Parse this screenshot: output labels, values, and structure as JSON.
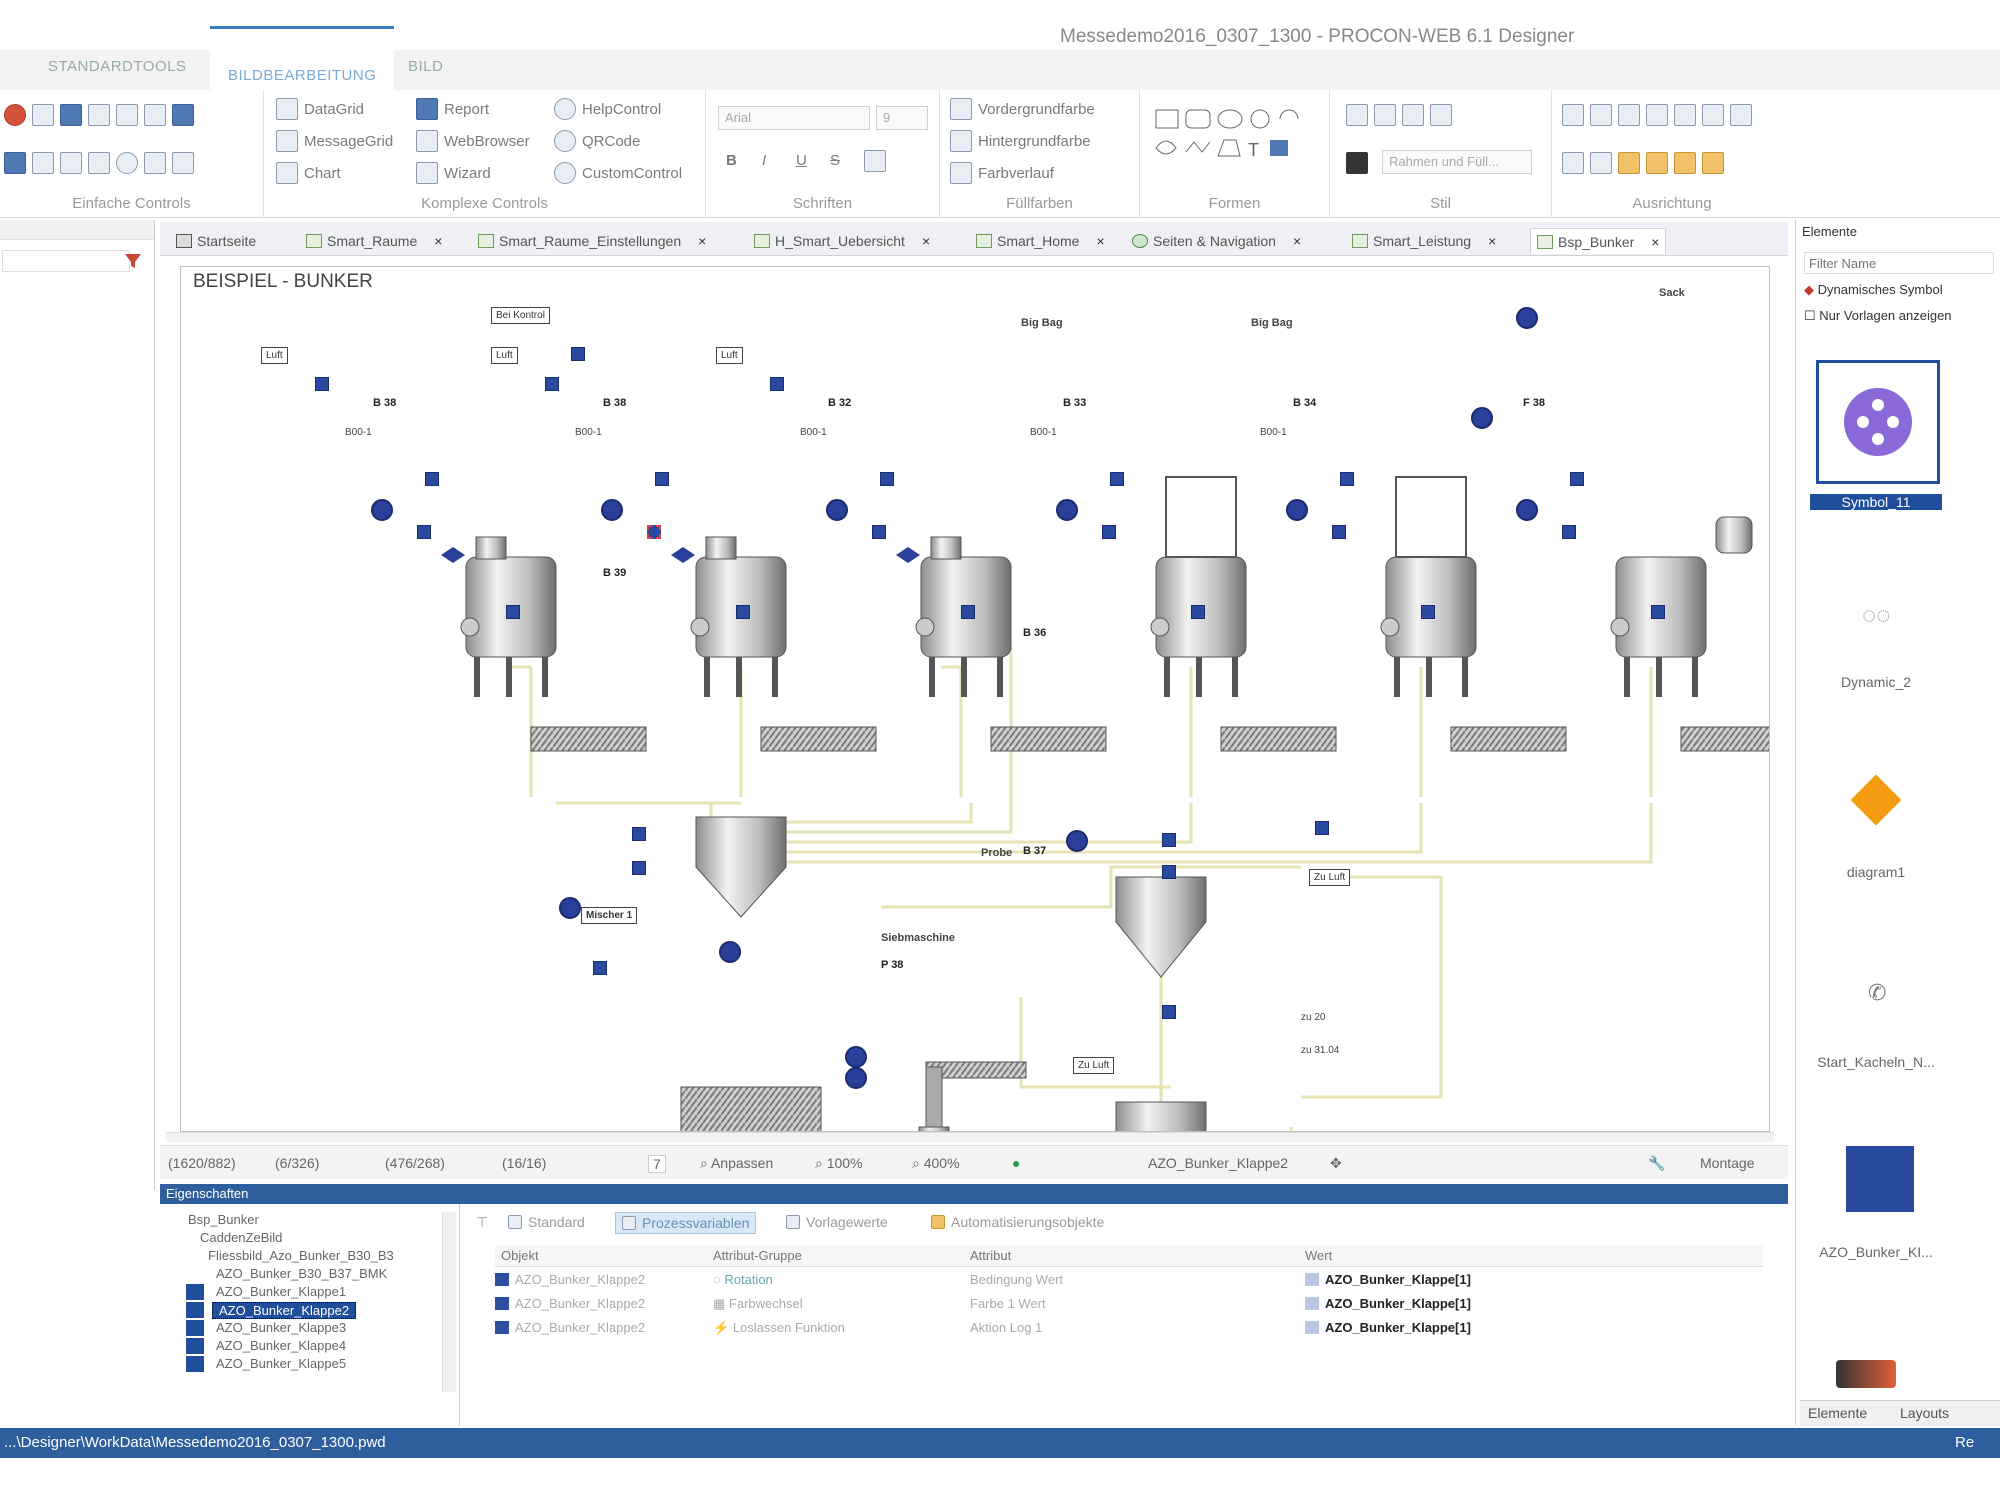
{
  "window": {
    "title": "Messedemo2016_0307_1300 - PROCON-WEB 6.1 Designer"
  },
  "ribbon_tabs": [
    "STANDARDTOOLS",
    "BILDBEARBEITUNG",
    "BILD"
  ],
  "ribbon": {
    "groups": {
      "einfache": "Einfache Controls",
      "komplexe": "Komplexe Controls",
      "schriften": "Schriften",
      "fuellfarben": "Füllfarben",
      "formen": "Formen",
      "stil": "Stil",
      "ausrichtung": "Ausrichtung"
    },
    "komplexe_items": [
      "DataGrid",
      "MessageGrid",
      "Chart",
      "Report",
      "WebBrowser",
      "Wizard",
      "HelpControl",
      "QRCode",
      "CustomControl"
    ],
    "font_name": "Arial",
    "font_size": "9",
    "fill_items": [
      "Vordergrundfarbe",
      "Hintergrundfarbe",
      "Farbverlauf"
    ],
    "style_field": "Rahmen und Füll..."
  },
  "doc_tabs": [
    "Startseite",
    "Smart_Raume",
    "Smart_Raume_Einstellungen",
    "H_Smart_Uebersicht",
    "Smart_Home",
    "Seiten & Navigation",
    "Smart_Leistung",
    "Bsp_Bunker"
  ],
  "canvas": {
    "heading": "BEISPIEL - BUNKER",
    "luft": "Luft",
    "big_bag": "Big Bag",
    "sack": "Sack",
    "bei_kontrol": "Bei Kontrol",
    "mischer": "Mischer 1",
    "probe": "Probe",
    "siebmaschine": "Siebmaschine",
    "tanks": [
      "B 38",
      "B 38",
      "B 32",
      "B 33",
      "B 34",
      "F 38"
    ],
    "collector_tag": "B 39",
    "hopper_tag": "B 36",
    "lower_hopper_tag": "B 37",
    "sieve_tag": "P 38",
    "zu_luft_1": "Zu Luft",
    "zu_luft_2": "Zu Luft",
    "dest_1": "zu 20",
    "dest_2": "zu 31.04",
    "tag_small": "B00-1"
  },
  "status_strip": {
    "coords": [
      "(1620/882)",
      "(6/326)",
      "(476/268)",
      "(16/16)"
    ],
    "zoom_step": "7",
    "fit": "Anpassen",
    "zoom1": "100%",
    "zoom2": "400%",
    "selection": "AZO_Bunker_Klappe2",
    "mode": "Montage"
  },
  "properties": {
    "header": "Eigenschaften",
    "tree": [
      "Bsp_Bunker",
      "CaddenZeBild",
      "Fliessbild_Azo_Bunker_B30_B3",
      "AZO_Bunker_B30_B37_BMK",
      "AZO_Bunker_Klappe1",
      "AZO_Bunker_Klappe2",
      "AZO_Bunker_Klappe3",
      "AZO_Bunker_Klappe4",
      "AZO_Bunker_Klappe5"
    ],
    "tabs": [
      "Standard",
      "Prozessvariablen",
      "Vorlagewerte",
      "Automatisierungsobjekte"
    ],
    "columns": [
      "Objekt",
      "Attribut-Gruppe",
      "Attribut",
      "Wert"
    ],
    "rows": [
      {
        "objekt": "AZO_Bunker_Klappe2",
        "gruppe": "Rotation",
        "attribut": "Bedingung Wert",
        "wert": "AZO_Bunker_Klappe[1]"
      },
      {
        "objekt": "AZO_Bunker_Klappe2",
        "gruppe": "Farbwechsel",
        "attribut": "Farbe 1 Wert",
        "wert": "AZO_Bunker_Klappe[1]"
      },
      {
        "objekt": "AZO_Bunker_Klappe2",
        "gruppe": "Loslassen Funktion",
        "attribut": "Aktion Log 1",
        "wert": "AZO_Bunker_Klappe[1]"
      }
    ]
  },
  "elements_panel": {
    "title": "Elemente",
    "filter_placeholder": "Filter Name",
    "symbol_type": "Dynamisches Symbol",
    "nur_vorlagen": "Nur Vorlagen anzeigen",
    "items": [
      "Symbol_11",
      "Dynamic_2",
      "diagram1",
      "Start_Kacheln_N...",
      "AZO_Bunker_KI..."
    ],
    "bottom_tabs": [
      "Elemente",
      "Layouts"
    ]
  },
  "statusbar": {
    "path": "...\\Designer\\WorkData\\Messedemo2016_0307_1300.pwd",
    "right": "Re"
  },
  "colors": {
    "accent": "#2e5e9e",
    "signal": "#2a3f99",
    "pipe": "#e8e6b8"
  }
}
